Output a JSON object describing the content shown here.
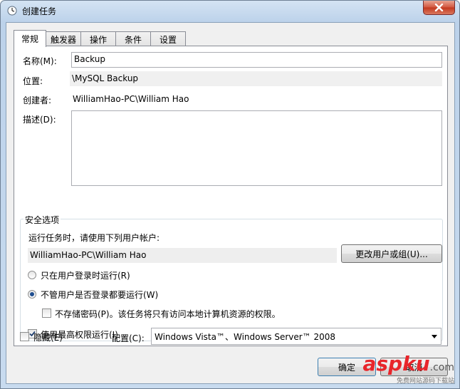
{
  "window": {
    "title": "创建任务",
    "title_icon": "clock-icon",
    "close_icon": "close-icon"
  },
  "tabs": [
    {
      "label": "常规",
      "active": true
    },
    {
      "label": "触发器",
      "active": false
    },
    {
      "label": "操作",
      "active": false
    },
    {
      "label": "条件",
      "active": false
    },
    {
      "label": "设置",
      "active": false
    }
  ],
  "general": {
    "name_label": "名称(M):",
    "name_value": "Backup",
    "location_label": "位置:",
    "location_value": "\\MySQL Backup",
    "author_label": "创建者:",
    "author_value": "WilliamHao-PC\\William Hao",
    "description_label": "描述(D):",
    "description_value": ""
  },
  "security": {
    "group_title": "安全选项",
    "run_as_label": "运行任务时，请使用下列用户帐户:",
    "user_account": "WilliamHao-PC\\William Hao",
    "change_user_button": "更改用户或组(U)...",
    "radio_logged_on": "只在用户登录时运行(R)",
    "radio_logged_on_selected": false,
    "radio_whether": "不管用户是否登录都要运行(W)",
    "radio_whether_selected": true,
    "no_store_password": "不存储密码(P)。该任务将只有访问本地计算机资源的权限。",
    "no_store_password_checked": false,
    "highest_privileges": "使用最高权限运行(I)",
    "highest_privileges_checked": true
  },
  "bottom": {
    "hidden_label": "隐藏(E)",
    "hidden_checked": false,
    "config_label": "配置(C):",
    "config_value": "Windows Vista™、Windows Server™ 2008"
  },
  "buttons": {
    "ok": "确定",
    "cancel": "取消"
  },
  "watermark": {
    "brand": "aspku",
    "suffix": ".com",
    "tagline": "免费网站源码下载站"
  },
  "colors": {
    "title_gradient_top": "#d4e3f3",
    "close_red": "#c3381d",
    "radio_dot": "#1f4e8f",
    "watermark_red": "#e8262b"
  }
}
